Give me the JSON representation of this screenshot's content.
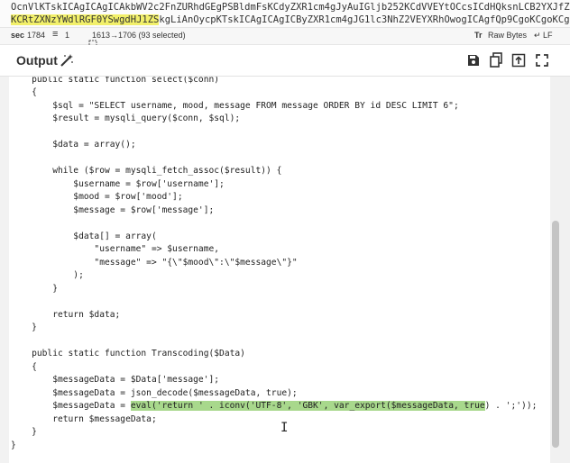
{
  "input": {
    "line1": "OcnVlKTskICAgICAgICAkbWV2c2FnZURhdGEgPSBldmFsKCdyZXR1cm4gJyAuIGljb252KCdVVEYtOCcsICdHQksnLCB2YXJfZXhwb3J0",
    "line2_highlight": "KCRtZXNzYWdlRGF0YSwgdHJ1ZS",
    "line2_rest": "kgLiAnOycpKTskICAgICAgICByZXR1cm4gJG1lc3NhZ2VEYXRhOwogICAgfQp9CgoKCgoKCgoKCg=="
  },
  "status": {
    "length_label": "sec",
    "length": "1784",
    "lines_label": "≡",
    "lines": "1",
    "selection": "1613→1706 (93 selected)",
    "font_label": "Tr",
    "encoding": "Raw Bytes",
    "eol": "↵ LF"
  },
  "output": {
    "title": "Output"
  },
  "code": [
    {
      "text": "    public static function select($conn)"
    },
    {
      "text": "    {"
    },
    {
      "text": "        $sql = \"SELECT username, mood, message FROM message ORDER BY id DESC LIMIT 6\";"
    },
    {
      "text": "        $result = mysqli_query($conn, $sql);"
    },
    {
      "text": ""
    },
    {
      "text": "        $data = array();"
    },
    {
      "text": ""
    },
    {
      "text": "        while ($row = mysqli_fetch_assoc($result)) {"
    },
    {
      "text": "            $username = $row['username'];"
    },
    {
      "text": "            $mood = $row['mood'];"
    },
    {
      "text": "            $message = $row['message'];"
    },
    {
      "text": ""
    },
    {
      "text": "            $data[] = array("
    },
    {
      "text": "                \"username\" => $username,"
    },
    {
      "text": "                \"message\" => \"{\\\"$mood\\\":\\\"$message\\\"}\""
    },
    {
      "text": "            );"
    },
    {
      "text": "        }"
    },
    {
      "text": ""
    },
    {
      "text": "        return $data;"
    },
    {
      "text": "    }"
    },
    {
      "text": ""
    },
    {
      "text": "    public static function Transcoding($Data)"
    },
    {
      "text": "    {"
    },
    {
      "text": "        $messageData = $Data['message'];"
    },
    {
      "text": "        $messageData = json_decode($messageData, true);"
    },
    {
      "pre": "        $messageData = ",
      "sel": "eval('return ' . iconv('UTF-8', 'GBK', var_export($messageData, true",
      "post": ") . ';'));"
    },
    {
      "text": "        return $messageData;"
    },
    {
      "text": "    }"
    },
    {
      "text": "}"
    }
  ]
}
